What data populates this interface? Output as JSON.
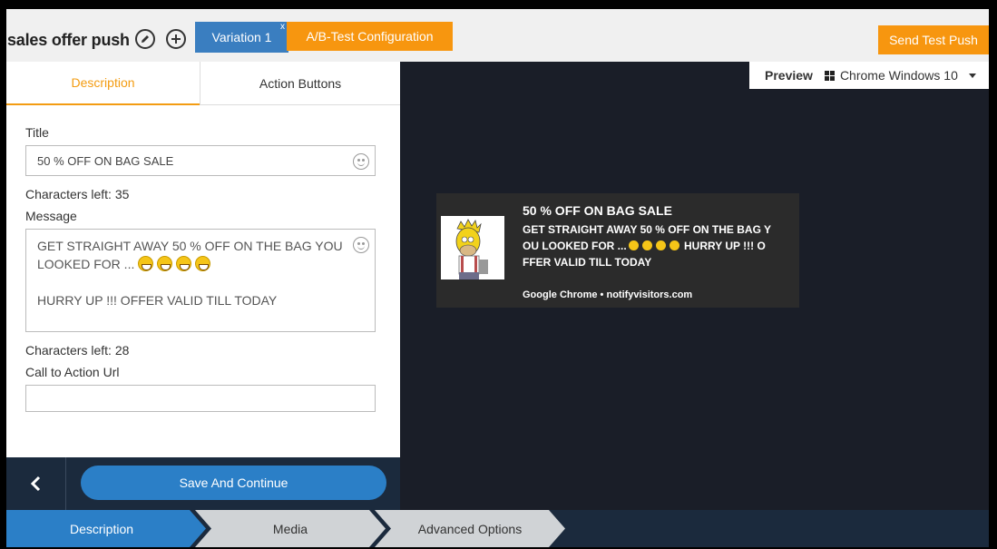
{
  "header": {
    "campaign_title": "sales offer push",
    "edit_icon": "pencil-icon",
    "add_icon": "plus-icon",
    "variation_tab": "Variation 1",
    "variation_close": "x",
    "ab_test_label": "A/B-Test Configuration",
    "send_test_label": "Send Test Push"
  },
  "tabs": {
    "description": "Description",
    "action_buttons": "Action Buttons"
  },
  "form": {
    "title_label": "Title",
    "title_value": "50 % OFF ON BAG SALE",
    "title_chars_left": "Characters left: 35",
    "message_label": "Message",
    "message_line1": "GET STRAIGHT AWAY 50 % OFF ON THE BAG YOU",
    "message_line2": "LOOKED FOR ...",
    "message_line3": "HURRY UP !!! OFFER VALID TILL TODAY",
    "message_chars_left": "Characters left: 28",
    "cta_label": "Call to Action Url",
    "cta_value": ""
  },
  "bottom_nav": {
    "back_icon": "chevron-left-icon",
    "save_label": "Save And Continue"
  },
  "preview": {
    "label": "Preview",
    "os_icon": "windows-icon",
    "selected_platform": "Chrome Windows 10"
  },
  "notification": {
    "title": "50 % OFF ON BAG SALE",
    "body_line1": "GET STRAIGHT AWAY 50 % OFF ON THE BAG Y",
    "body_line2_a": "OU LOOKED FOR ...",
    "body_line2_b": "HURRY UP !!! O",
    "body_line3": "FFER VALID TILL TODAY",
    "source": "Google Chrome • notifyvisitors.com"
  },
  "stepper": {
    "steps": [
      "Description",
      "Media",
      "Advanced Options"
    ]
  },
  "colors": {
    "accent_orange": "#f7960f",
    "primary_blue": "#2b7fc7",
    "dark_bg": "#1a1e28"
  }
}
